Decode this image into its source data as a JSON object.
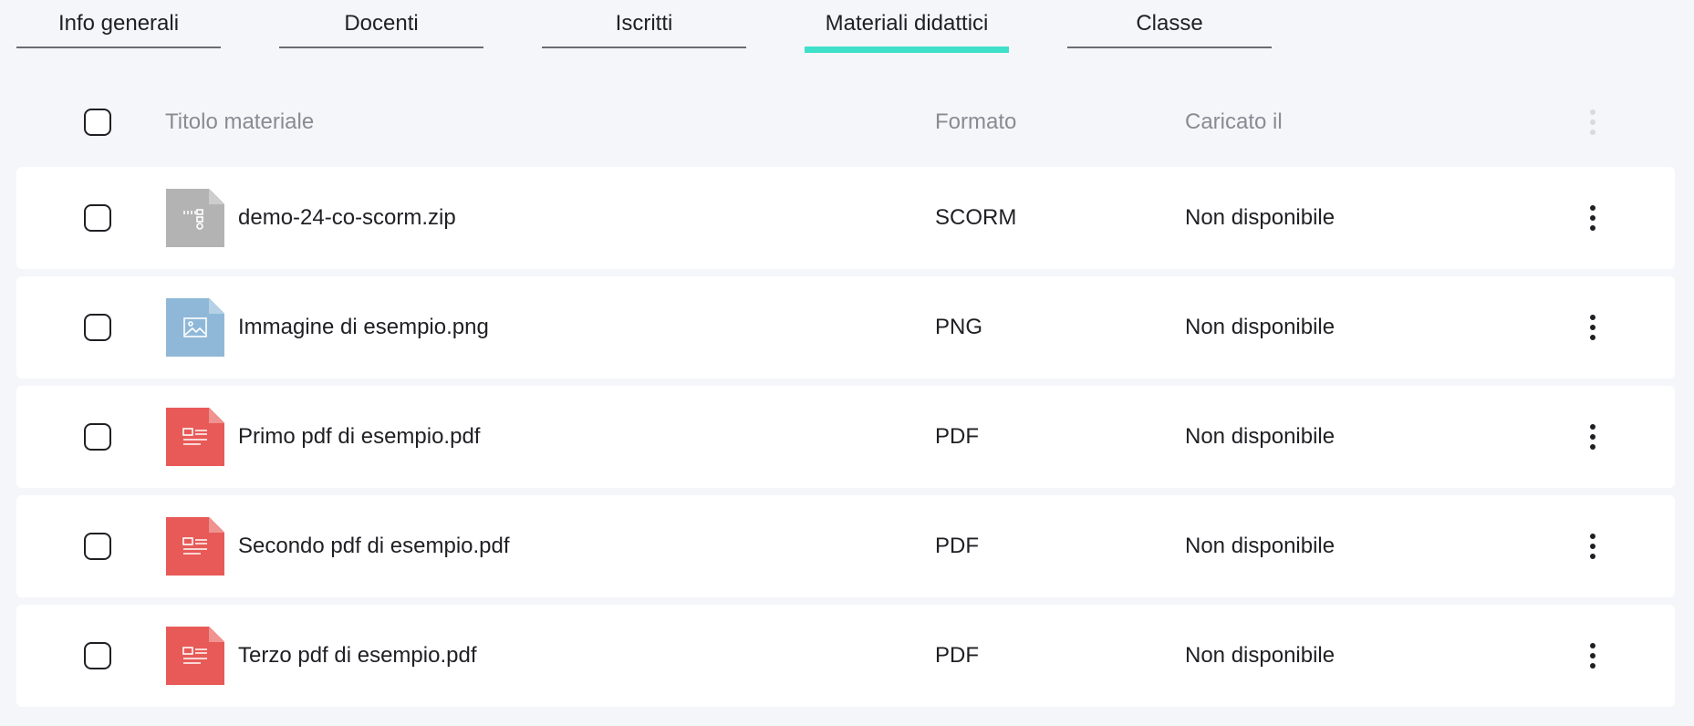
{
  "tabs": [
    {
      "label": "Info generali",
      "active": false
    },
    {
      "label": "Docenti",
      "active": false
    },
    {
      "label": "Iscritti",
      "active": false
    },
    {
      "label": "Materiali didattici",
      "active": true
    },
    {
      "label": "Classe",
      "active": false
    }
  ],
  "colors": {
    "active_tab_underline": "#3ee0c9",
    "zip_icon": "#b3b3b3",
    "image_icon": "#8fb8d8",
    "pdf_icon": "#e75a57"
  },
  "table": {
    "headers": {
      "title": "Titolo materiale",
      "format": "Formato",
      "uploaded": "Caricato il"
    },
    "rows": [
      {
        "title": "demo-24-co-scorm.zip",
        "format": "SCORM",
        "uploaded": "Non disponibile",
        "icon": "zip-file-icon"
      },
      {
        "title": "Immagine di esempio.png",
        "format": "PNG",
        "uploaded": "Non disponibile",
        "icon": "image-file-icon"
      },
      {
        "title": "Primo pdf di esempio.pdf",
        "format": "PDF",
        "uploaded": "Non disponibile",
        "icon": "pdf-file-icon"
      },
      {
        "title": "Secondo pdf di esempio.pdf",
        "format": "PDF",
        "uploaded": "Non disponibile",
        "icon": "pdf-file-icon"
      },
      {
        "title": "Terzo pdf di esempio.pdf",
        "format": "PDF",
        "uploaded": "Non disponibile",
        "icon": "pdf-file-icon"
      }
    ]
  }
}
